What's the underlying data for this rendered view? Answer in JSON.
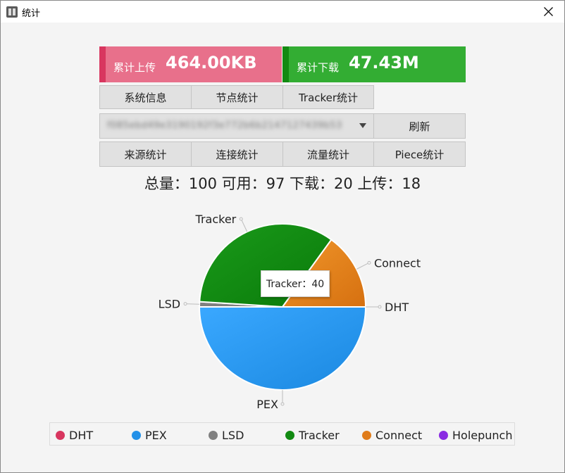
{
  "window": {
    "title": "统计",
    "icon": "app-icon",
    "close_icon": "close-icon"
  },
  "stats": {
    "upload_label": "累计上传",
    "upload_value": "464.00KB",
    "download_label": "累计下载",
    "download_value": "47.43M"
  },
  "tabs_row1": [
    "系统信息",
    "节点统计",
    "Tracker统计"
  ],
  "hash_select": {
    "value": "f085ebd49e3190192f3e772b6b2147127439b53"
  },
  "refresh_label": "刷新",
  "tabs_row2": [
    "来源统计",
    "连接统计",
    "流量统计",
    "Piece统计"
  ],
  "summary": "总量：100 可用：97 下载：20 上传：18",
  "tooltip": "Tracker：40",
  "chart_data": {
    "type": "pie",
    "slices": [
      {
        "label": "DHT",
        "value": 0,
        "color": "#d8365f"
      },
      {
        "label": "PEX",
        "value": 50,
        "color": "#2391e8"
      },
      {
        "label": "LSD",
        "value": 1,
        "color": "#808080"
      },
      {
        "label": "Tracker",
        "value": 34,
        "color": "#128a12"
      },
      {
        "label": "Connect",
        "value": 15,
        "color": "#e07c1a"
      },
      {
        "label": "Holepunch",
        "value": 0,
        "color": "#8a2be2"
      }
    ],
    "legend": {
      "position": "bottom"
    }
  },
  "legend": [
    {
      "label": "DHT",
      "color": "#d8365f"
    },
    {
      "label": "PEX",
      "color": "#2391e8"
    },
    {
      "label": "LSD",
      "color": "#808080"
    },
    {
      "label": "Tracker",
      "color": "#128a12"
    },
    {
      "label": "Connect",
      "color": "#e07c1a"
    },
    {
      "label": "Holepunch",
      "color": "#8a2be2"
    }
  ]
}
